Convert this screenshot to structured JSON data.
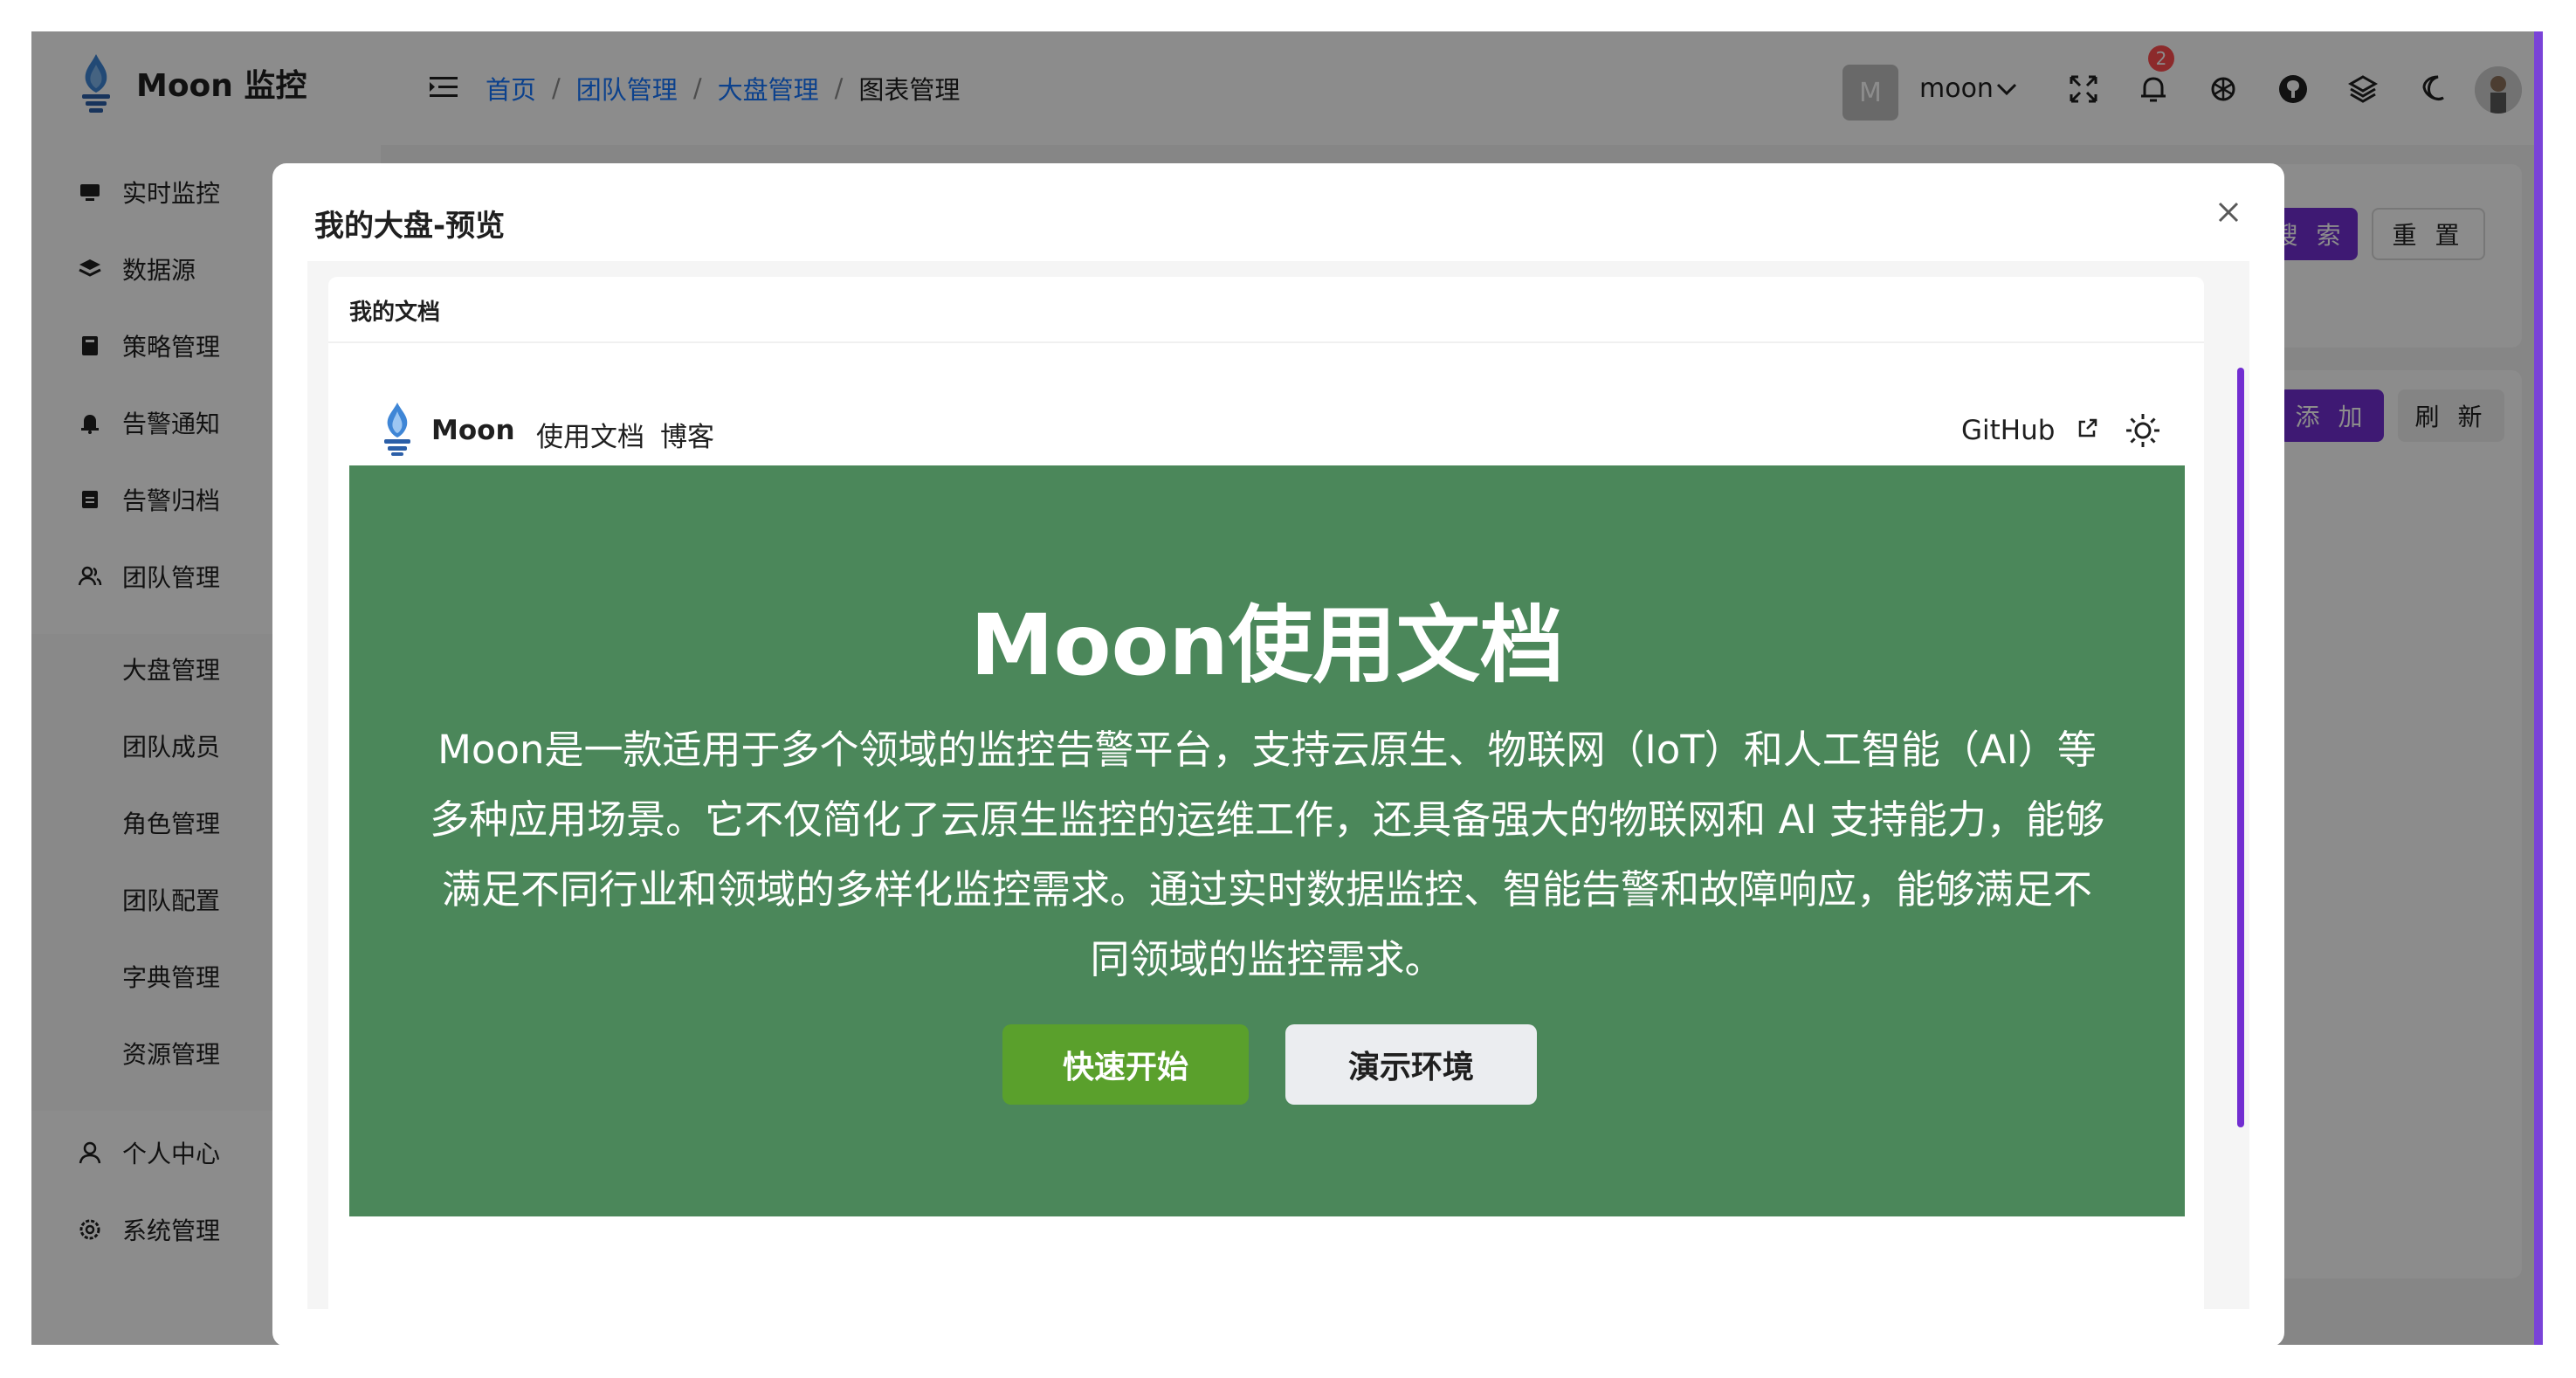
{
  "app": {
    "brand": "Moon 监控",
    "breadcrumb": [
      "首页",
      "团队管理",
      "大盘管理",
      "图表管理"
    ],
    "breadcrumb_sep": "/",
    "user": {
      "initial": "M",
      "name": "moon"
    },
    "notifications": {
      "count": "2"
    }
  },
  "sidebar": {
    "items": [
      {
        "label": "实时监控",
        "icon": "monitor-icon"
      },
      {
        "label": "数据源",
        "icon": "layers-icon"
      },
      {
        "label": "策略管理",
        "icon": "book-icon"
      },
      {
        "label": "告警通知",
        "icon": "bell-icon"
      },
      {
        "label": "告警归档",
        "icon": "archive-icon"
      },
      {
        "label": "团队管理",
        "icon": "team-icon"
      }
    ],
    "sub_items": [
      "大盘管理",
      "团队成员",
      "角色管理",
      "团队配置",
      "字典管理",
      "资源管理"
    ],
    "bottom_items": [
      {
        "label": "个人中心",
        "icon": "user-icon"
      },
      {
        "label": "系统管理",
        "icon": "settings-icon"
      }
    ]
  },
  "background": {
    "search_label": "搜 索",
    "reset_label": "重 置",
    "add_label": "添 加",
    "refresh_label": "刷 新"
  },
  "modal": {
    "title": "我的大盘-预览",
    "card_title": "我的文档",
    "doc": {
      "brand": "Moon",
      "nav_links": [
        "使用文档",
        "博客"
      ],
      "github": "GitHub",
      "hero_title": "Moon使用文档",
      "hero_desc_lines": [
        "Moon是一款适用于多个领域的监控告警平台，支持云原生、物联网（IoT）和人工智能（AI）等",
        "多种应用场景。它不仅简化了云原生监控的运维工作，还具备强大的物联网和 AI 支持能力，能够",
        "满足不同行业和领域的多样化监控需求。通过实时数据监控、智能告警和故障响应，能够满足不",
        "同领域的监控需求。"
      ],
      "btn_start": "快速开始",
      "btn_demo": "演示环境"
    }
  },
  "colors": {
    "primary": "#722ed1",
    "link": "#1677ff",
    "hero_bg": "#4b875a",
    "start_btn": "#5aa02c",
    "badge": "#ff4d4f"
  }
}
